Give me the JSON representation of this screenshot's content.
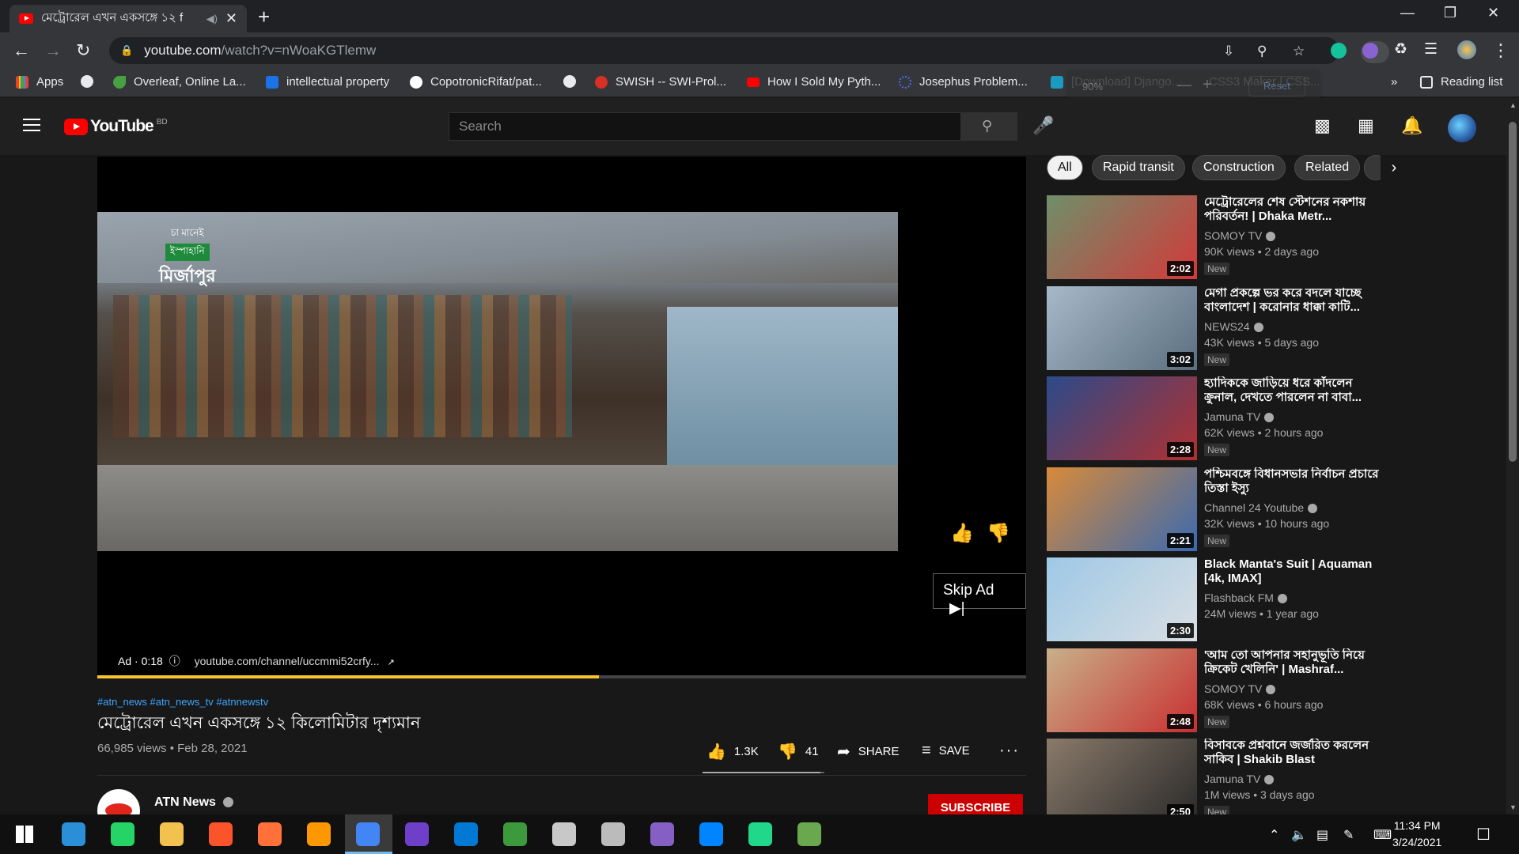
{
  "browser": {
    "tab_title": "মেট্রোরেল এখন একসঙ্গে ১২ f",
    "url_host": "youtube.com",
    "url_path": "/watch?v=nWoaKGTlemw"
  },
  "bookmarks": [
    {
      "label": "Apps",
      "color": "#4285f4"
    },
    {
      "label": "",
      "color": "#e8eaed"
    },
    {
      "label": "Overleaf, Online La...",
      "color": "#47a141"
    },
    {
      "label": "intellectual property",
      "color": "#1a73e8"
    },
    {
      "label": "CopotronicRifat/pat...",
      "color": "#ffffff"
    },
    {
      "label": "",
      "color": "#e8eaed"
    },
    {
      "label": "SWISH -- SWI-Prol...",
      "color": "#d93025"
    },
    {
      "label": "How I Sold My Pyth...",
      "color": "#ff0000"
    },
    {
      "label": "Josephus Problem...",
      "color": "#4a6cf7"
    },
    {
      "label": "[Download] Django...",
      "color": "#1a9bbf"
    },
    {
      "label": "CSS3 Maker | CSS...",
      "color": "#888888"
    }
  ],
  "reading_list": "Reading list",
  "zoom_popup": {
    "level": "90%",
    "reset": "Reset"
  },
  "youtube": {
    "logo_text": "YouTube",
    "country_code": "BD",
    "search_placeholder": "Search"
  },
  "player": {
    "overlay_line1": "চা মানেই",
    "overlay_line2": "ইস্পাহানি",
    "overlay_line3": "মির্জাপুর",
    "skip_label": "Skip Ad",
    "ad_timer": "Ad · 0:18",
    "ad_url": "youtube.com/channel/uccmmi52crfy...",
    "ad_progress": 0.54
  },
  "video": {
    "hashtags": "#atn_news #atn_news_tv #atnnewstv",
    "title": "মেট্রোরেল এখন একসঙ্গে ১২ কিলোমিটার দৃশ্যমান",
    "meta": "66,985 views • Feb 28, 2021",
    "likes": "1.3K",
    "dislikes": "41",
    "like_ratio": 0.97,
    "share": "SHARE",
    "save": "SAVE"
  },
  "channel": {
    "name": "ATN News",
    "subscribe": "SUBSCRIBE"
  },
  "chips": [
    "All",
    "Rapid transit",
    "Construction",
    "Related"
  ],
  "recommendations": [
    {
      "title": "মেট্রোরেলের শেষ স্টেশনের নকশায় পরিবর্তন! | Dhaka Metr...",
      "channel": "SOMOY TV",
      "stats": "90K views • 2 days ago",
      "duration": "2:02",
      "badge": "New",
      "colors": [
        "#6f8f6a",
        "#d23a3a"
      ]
    },
    {
      "title": "মেগা প্রকল্পে ভর করে বদলে যাচ্ছে বাংলাদেশ | করোনার ধাক্কা কাটি...",
      "channel": "NEWS24",
      "stats": "43K views • 5 days ago",
      "duration": "3:02",
      "badge": "New",
      "colors": [
        "#a7b9c9",
        "#5b6f80"
      ]
    },
    {
      "title": "হ্যাদিককে জাড়িয়ে ধরে কাঁদলেন ক্রুনাল, দেখতে পারলেন না বাবা...",
      "channel": "Jamuna TV",
      "stats": "62K views • 2 hours ago",
      "duration": "2:28",
      "badge": "New",
      "colors": [
        "#2c4a8a",
        "#b03030"
      ]
    },
    {
      "title": "পশ্চিমবঙ্গে বিধানসভার নির্বাচন প্রচারে তিস্তা ইস্যু",
      "channel": "Channel 24 Youtube",
      "stats": "32K views • 10 hours ago",
      "duration": "2:21",
      "badge": "New",
      "colors": [
        "#d88a3a",
        "#3a6ab0"
      ]
    },
    {
      "title": "Black Manta's Suit | Aquaman [4k, IMAX]",
      "channel": "Flashback FM",
      "stats": "24M views • 1 year ago",
      "duration": "2:30",
      "badge": "",
      "colors": [
        "#9ec8e6",
        "#d9dfe3"
      ]
    },
    {
      "title": "'আম তো আপনার সহানুভূতি নিয়ে ক্রিকেট খেলিনি' | Mashraf...",
      "channel": "SOMOY TV",
      "stats": "68K views • 6 hours ago",
      "duration": "2:48",
      "badge": "New",
      "colors": [
        "#c8b08a",
        "#c83030"
      ]
    },
    {
      "title": "বিসাবকে প্রশ্নবানে জর্জরিত করলেন সাকিব | Shakib Blast",
      "channel": "Jamuna TV",
      "stats": "1M views • 3 days ago",
      "duration": "2:50",
      "badge": "New",
      "colors": [
        "#8a7a6a",
        "#2a2a2a"
      ]
    }
  ],
  "taskbar": {
    "time": "11:34 PM",
    "date": "3/24/2021",
    "apps": [
      {
        "name": "windows-start",
        "color": "#ffffff"
      },
      {
        "name": "edge",
        "color": "#2b8fd8"
      },
      {
        "name": "whatsapp",
        "color": "#25d366"
      },
      {
        "name": "file-explorer",
        "color": "#f2c14e"
      },
      {
        "name": "brave",
        "color": "#fb542b"
      },
      {
        "name": "firefox",
        "color": "#ff7139"
      },
      {
        "name": "sublime",
        "color": "#ff9800"
      },
      {
        "name": "chrome",
        "color": "#4285f4"
      },
      {
        "name": "github-desktop",
        "color": "#6e40c9"
      },
      {
        "name": "vscode",
        "color": "#0078d4"
      },
      {
        "name": "earth",
        "color": "#3c9a3c"
      },
      {
        "name": "app-balloon",
        "color": "#c8c8c8"
      },
      {
        "name": "app-satellite",
        "color": "#bbbbbb"
      },
      {
        "name": "visual-studio",
        "color": "#865fc5"
      },
      {
        "name": "messenger",
        "color": "#0084ff"
      },
      {
        "name": "pycharm",
        "color": "#21d789"
      },
      {
        "name": "app-chart",
        "color": "#6aa84f"
      }
    ]
  }
}
